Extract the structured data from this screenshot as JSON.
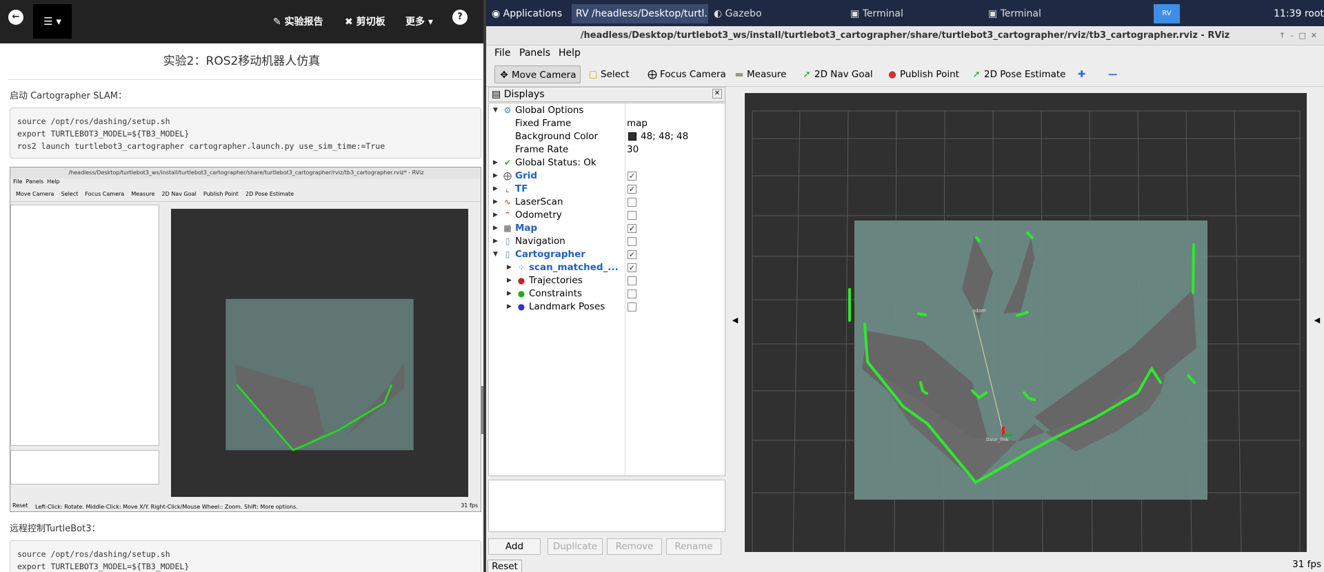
{
  "browser": {
    "toolbar": {
      "report": "实验报告",
      "clipboard": "剪切板",
      "more": "更多"
    },
    "page_title": "实验2：ROS2移动机器人仿真",
    "para1": "启动 Cartographer SLAM：",
    "code1": "source /opt/ros/dashing/setup.sh\nexport TURTLEBOT3_MODEL=${TB3_MODEL}\nros2 launch turtlebot3_cartographer cartographer.launch.py use_sim_time:=True",
    "para2": "远程控制TurtleBot3：",
    "code2": "source /opt/ros/dashing/setup.sh\nexport TURTLEBOT3_MODEL=${TB3_MODEL}",
    "thumb": {
      "title": "/headless/Desktop/turtlebot3_ws/install/turtlebot3_cartographer/share/turtlebot3_cartographer/rviz/tb3_cartographer.rviz* - RViz",
      "status": "Left-Click: Rotate. Middle-Click: Move X/Y. Right-Click/Mouse Wheel:: Zoom. Shift: More options.",
      "fps": "31 fps",
      "reset": "Reset"
    }
  },
  "taskbar": {
    "applications": "Applications",
    "tasks": [
      "/headless/Desktop/turtl...",
      "Gazebo",
      "Terminal",
      "Terminal"
    ],
    "clock": "11:39",
    "user": "root"
  },
  "rviz": {
    "title": "/headless/Desktop/turtlebot3_ws/install/turtlebot3_cartographer/share/turtlebot3_cartographer/rviz/tb3_cartographer.rviz - RViz",
    "menu": [
      "File",
      "Panels",
      "Help"
    ],
    "tools": [
      "Move Camera",
      "Select",
      "Focus Camera",
      "Measure",
      "2D Nav Goal",
      "Publish Point",
      "2D Pose Estimate"
    ],
    "displays_title": "Displays",
    "global_options": "Global Options",
    "fixed_frame_label": "Fixed Frame",
    "fixed_frame_value": "map",
    "bg_color_label": "Background Color",
    "bg_color_value": "48; 48; 48",
    "frame_rate_label": "Frame Rate",
    "frame_rate_value": "30",
    "global_status": "Global Status: Ok",
    "displays": [
      {
        "name": "Grid",
        "checked": true
      },
      {
        "name": "TF",
        "checked": true
      },
      {
        "name": "LaserScan",
        "checked": false
      },
      {
        "name": "Odometry",
        "checked": false
      },
      {
        "name": "Map",
        "checked": true
      },
      {
        "name": "Navigation",
        "checked": false
      },
      {
        "name": "Cartographer",
        "checked": true
      },
      {
        "name": "scan_matched_...",
        "checked": true
      },
      {
        "name": "Trajectories",
        "checked": false
      },
      {
        "name": "Constraints",
        "checked": false
      },
      {
        "name": "Landmark Poses",
        "checked": false
      }
    ],
    "buttons": [
      "Add",
      "Duplicate",
      "Remove",
      "Rename"
    ],
    "reset": "Reset",
    "fps": "31 fps",
    "colors": {
      "viewport_bg": "#303030",
      "map_free": "#6d8a85",
      "scan": "#22dd22"
    }
  }
}
